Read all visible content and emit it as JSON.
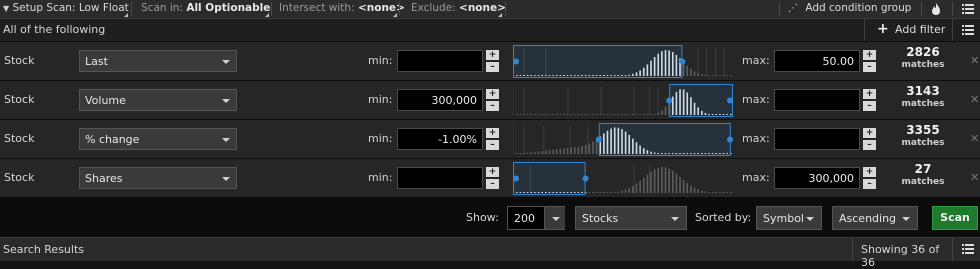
{
  "topbar": {
    "setup_scan_prefix": "Setup Scan: ",
    "setup_scan_value": "Low Float",
    "scan_in_prefix": "Scan in: ",
    "scan_in_value": "All Optionable",
    "intersect_prefix": "Intersect with: ",
    "intersect_value": "<none>",
    "exclude_prefix": "Exclude: ",
    "exclude_value": "<none>",
    "add_condition_group": "Add condition group"
  },
  "subheader": {
    "title": "All of the following",
    "add_filter": "Add filter"
  },
  "filters": [
    {
      "type": "Stock",
      "field": "Last",
      "min_label": "min:",
      "min_value": "",
      "max_label": "max:",
      "max_value": "50.00",
      "matches": "2826",
      "matches_label": "matches"
    },
    {
      "type": "Stock",
      "field": "Volume",
      "min_label": "min:",
      "min_value": "300,000",
      "max_label": "max:",
      "max_value": "",
      "matches": "3143",
      "matches_label": "matches"
    },
    {
      "type": "Stock",
      "field": "% change",
      "min_label": "min:",
      "min_value": "-1.00%",
      "max_label": "max:",
      "max_value": "",
      "matches": "3355",
      "matches_label": "matches"
    },
    {
      "type": "Stock",
      "field": "Shares",
      "min_label": "min:",
      "min_value": "",
      "max_label": "max:",
      "max_value": "300,000",
      "matches": "27",
      "matches_label": "matches"
    }
  ],
  "histogram_selection": [
    {
      "from": 0.0,
      "to": 0.77
    },
    {
      "from": 0.71,
      "to": 1.0
    },
    {
      "from": 0.39,
      "to": 0.99
    },
    {
      "from": 0.0,
      "to": 0.33
    }
  ],
  "bottombar": {
    "show_label": "Show:",
    "show_value": "200",
    "type_value": "Stocks",
    "sorted_by_label": "Sorted by:",
    "sort_field": "Symbol",
    "sort_order": "Ascending",
    "scan_button": "Scan"
  },
  "statusbar": {
    "title": "Search Results",
    "showing": "Showing 36 of 36"
  },
  "colors": {
    "accent": "#2f86d6",
    "scan_button": "#1f7a2e",
    "background": "#141414"
  }
}
